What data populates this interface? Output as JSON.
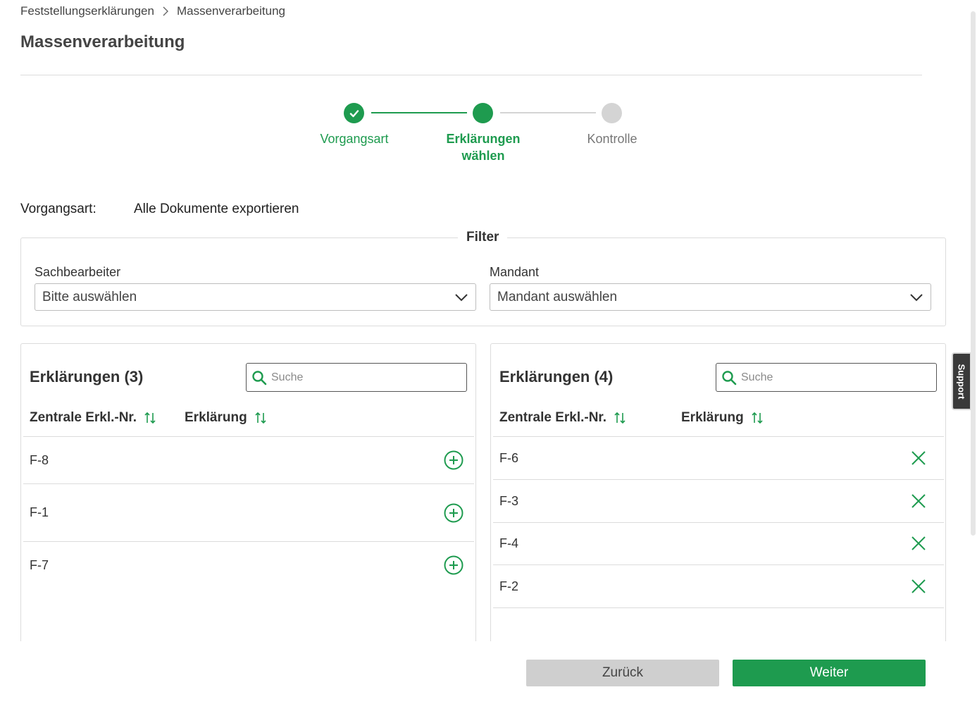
{
  "breadcrumb": {
    "items": [
      "Feststellungserklärungen",
      "Massenverarbeitung"
    ]
  },
  "page": {
    "title": "Massenverarbeitung"
  },
  "stepper": {
    "steps": [
      {
        "label": "Vorgangsart",
        "state": "done"
      },
      {
        "label_line1": "Erklärungen",
        "label_line2": "wählen",
        "state": "active"
      },
      {
        "label": "Kontrolle",
        "state": "pending"
      }
    ]
  },
  "summary": {
    "label": "Vorgangsart:",
    "value": "Alle Dokumente exportieren"
  },
  "filter": {
    "legend": "Filter",
    "sachbearbeiter": {
      "label": "Sachbearbeiter",
      "value": "Bitte auswählen"
    },
    "mandant": {
      "label": "Mandant",
      "value": "Mandant auswählen"
    }
  },
  "left_panel": {
    "title": "Erklärungen (3)",
    "search_placeholder": "Suche",
    "col_nr": "Zentrale Erkl.-Nr.",
    "col_erkl": "Erklärung",
    "rows": [
      "F-8",
      "F-1",
      "F-7"
    ]
  },
  "right_panel": {
    "title": "Erklärungen (4)",
    "search_placeholder": "Suche",
    "col_nr": "Zentrale Erkl.-Nr.",
    "col_erkl": "Erklärung",
    "rows": [
      "F-6",
      "F-3",
      "F-4",
      "F-2"
    ]
  },
  "footer": {
    "back_label": "Zurück",
    "next_label": "Weiter"
  },
  "support": {
    "label": "Support"
  },
  "colors": {
    "accent": "#1e9b4f",
    "inactive": "#d4d4d4",
    "text": "#333333"
  }
}
